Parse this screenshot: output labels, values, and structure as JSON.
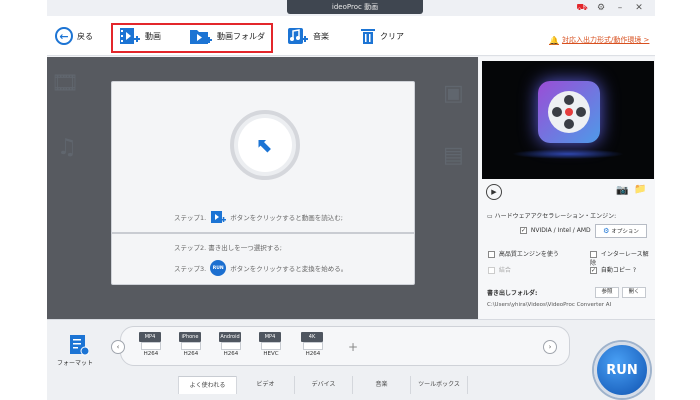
{
  "window": {
    "title": "ideoProc 動画"
  },
  "toolbar": {
    "back_label": "戻る",
    "video_label": "動画",
    "video_folder_label": "動画フォルダ",
    "music_label": "音楽",
    "clear_label": "クリア",
    "support_link": "対応入出力形式/動作環境 >"
  },
  "workarea": {
    "step1": "ステップ1.",
    "step1_text": "ボタンをクリックすると動画を読込む;",
    "step2": "ステップ2. 書き出しを一つ選択する;",
    "step3": "ステップ3.",
    "step3_text": "ボタンをクリックすると変換を始める。",
    "run_small": "RUN"
  },
  "right_panel": {
    "hw_title": "ハードウェアアクセラレーション・エンジン:",
    "nvidia_label": "NVIDIA / Intel / AMD",
    "option_label": "オプション",
    "hq_engine": "高品質エンジンを使う",
    "deinterlace": "インターレース解除",
    "merge": "結合",
    "auto_copy": "自動コピー ?",
    "output_folder_label": "書き出しフォルダ:",
    "browse_label": "参照",
    "open_label": "開く",
    "output_path": "C:\\Users\\yhira\\Videos\\VideoProc Converter AI"
  },
  "bottom": {
    "format_label": "フォーマット",
    "formats": [
      {
        "badge": "MP4",
        "codec": "H264"
      },
      {
        "badge": "iPhone",
        "codec": "H264"
      },
      {
        "badge": "Android",
        "codec": "H264"
      },
      {
        "badge": "MP4",
        "codec": "HEVC"
      },
      {
        "badge": "4K",
        "codec": "H264"
      }
    ],
    "tabs": [
      "よく使われる",
      "ビデオ",
      "デバイス",
      "音楽",
      "ツールボックス"
    ],
    "run_label": "RUN"
  },
  "colors": {
    "accent": "#1c74d4",
    "highlight": "#e3262b",
    "workarea_bg": "#575a60"
  }
}
